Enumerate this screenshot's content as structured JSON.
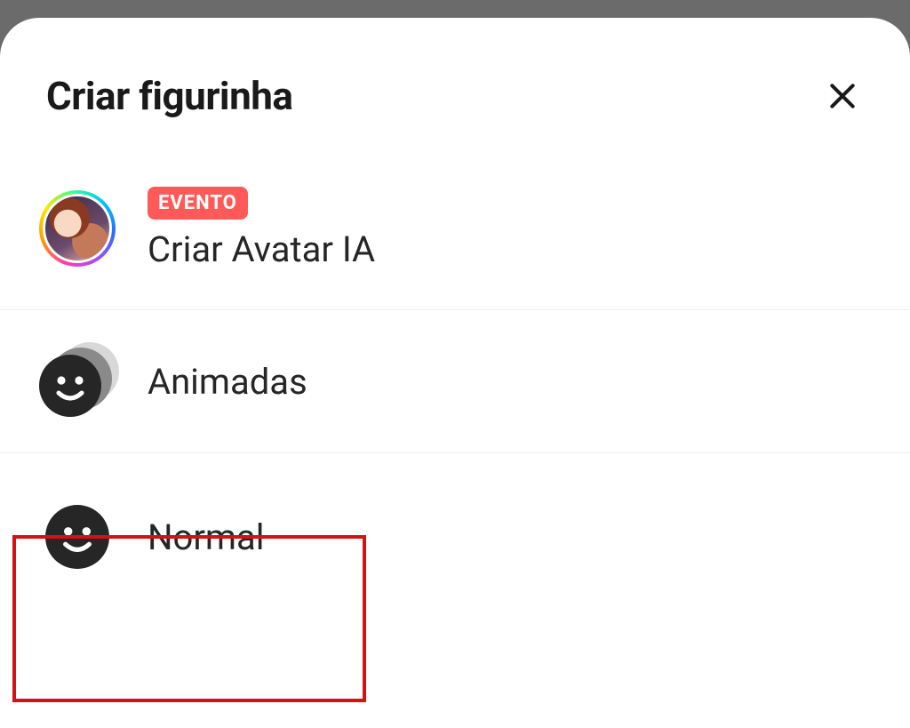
{
  "header": {
    "title": "Criar figurinha"
  },
  "options": {
    "avatar": {
      "badge": "EVENTO",
      "label": "Criar Avatar IA"
    },
    "animated": {
      "label": "Animadas"
    },
    "normal": {
      "label": "Normal"
    }
  },
  "colors": {
    "badge_bg": "#ff5a5a",
    "highlight_border": "#d31313"
  }
}
